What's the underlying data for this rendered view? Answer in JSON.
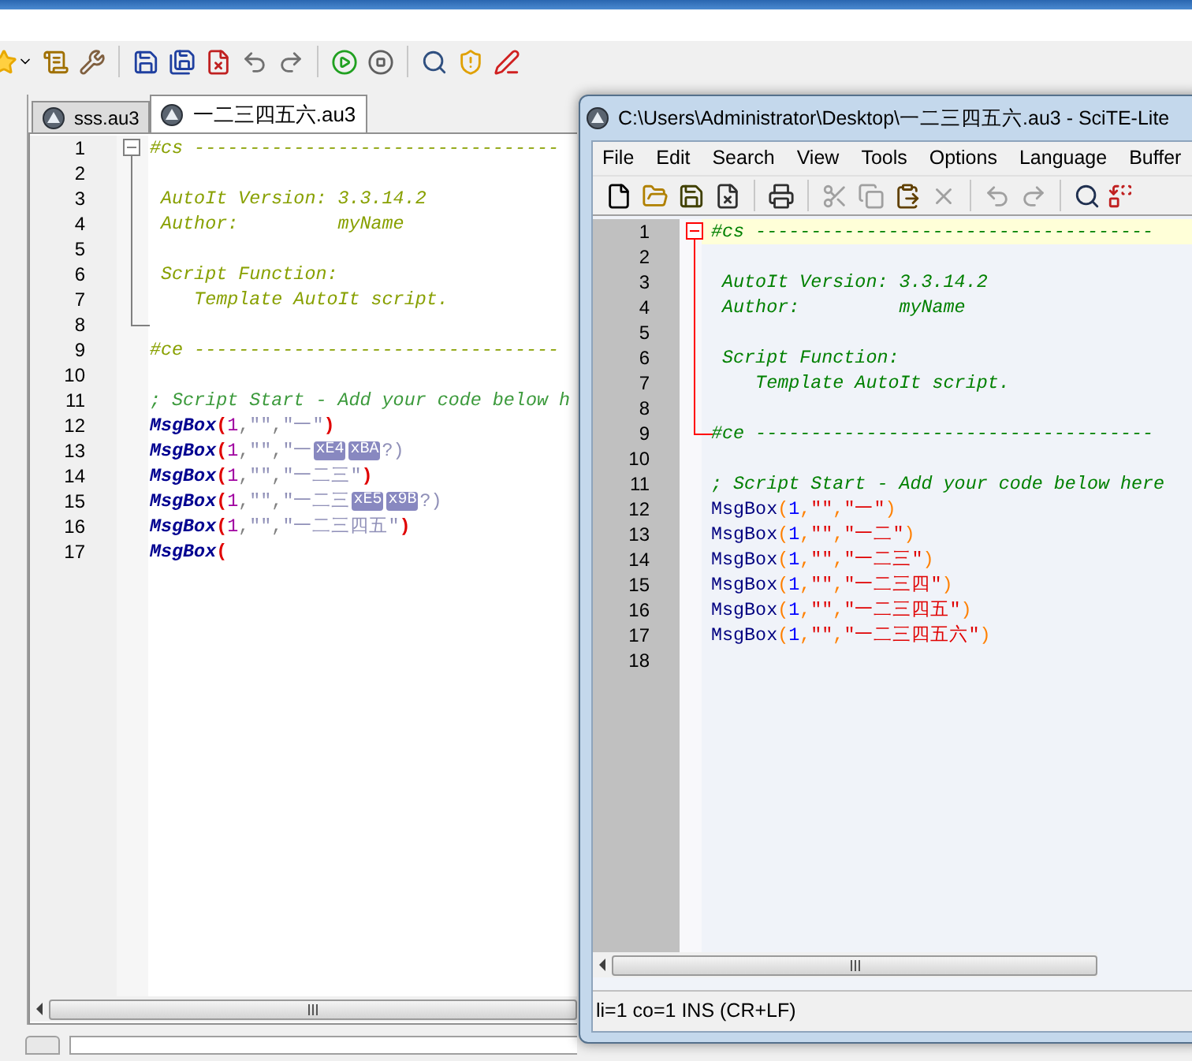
{
  "main_window": {
    "tabs": [
      {
        "label": "sss.au3",
        "selected": false
      },
      {
        "label": "一二三四五六.au3",
        "selected": true
      }
    ],
    "editor": {
      "lines": [
        {
          "number": "1",
          "expanded": true,
          "tokens": [
            {
              "kind": "block_comment",
              "text": "#cs ---------------------------------"
            }
          ],
          "children": [
            {
              "number": "2"
            },
            {
              "number": "3",
              "tokens": [
                {
                  "kind": "block_comment",
                  "text": " AutoIt Version: 3.3.14.2"
                }
              ]
            },
            {
              "number": "4",
              "tokens": [
                {
                  "kind": "block_comment",
                  "text": " Author:         myName"
                }
              ]
            },
            {
              "number": "5"
            },
            {
              "number": "6",
              "tokens": [
                {
                  "kind": "block_comment",
                  "text": " Script Function:"
                }
              ]
            },
            {
              "number": "7",
              "tokens": [
                {
                  "kind": "block_comment",
                  "text": "    Template AutoIt script."
                }
              ]
            },
            {
              "number": "8"
            }
          ]
        },
        {
          "number": "9",
          "tokens": [
            {
              "kind": "block_comment",
              "text": "#ce ---------------------------------"
            }
          ]
        },
        {
          "number": "10"
        },
        {
          "number": "11",
          "tokens": [
            {
              "kind": "line_comment",
              "text": "; Script Start - Add your code below h"
            }
          ]
        },
        {
          "number": "12",
          "tokens": [
            {
              "kind": "func",
              "text": "MsgBox"
            },
            {
              "kind": "paren",
              "text": "("
            },
            {
              "kind": "num",
              "text": "1"
            },
            {
              "kind": "op",
              "text": ","
            },
            {
              "kind": "str",
              "text": "\"\""
            },
            {
              "kind": "op",
              "text": ","
            },
            {
              "kind": "str",
              "text": "\"一\""
            },
            {
              "kind": "paren",
              "text": ")"
            }
          ]
        },
        {
          "number": "13",
          "tokens": [
            {
              "kind": "func",
              "text": "MsgBox"
            },
            {
              "kind": "paren",
              "text": "("
            },
            {
              "kind": "num",
              "text": "1"
            },
            {
              "kind": "op",
              "text": ","
            },
            {
              "kind": "str",
              "text": "\"\""
            },
            {
              "kind": "op",
              "text": ","
            },
            {
              "kind": "str",
              "text": "\"一"
            },
            {
              "kind": "byte",
              "text": "xE4"
            },
            {
              "kind": "byte",
              "text": "xBA"
            },
            {
              "kind": "str",
              "text": "?)"
            }
          ]
        },
        {
          "number": "14",
          "tokens": [
            {
              "kind": "func",
              "text": "MsgBox"
            },
            {
              "kind": "paren",
              "text": "("
            },
            {
              "kind": "num",
              "text": "1"
            },
            {
              "kind": "op",
              "text": ","
            },
            {
              "kind": "str",
              "text": "\"\""
            },
            {
              "kind": "op",
              "text": ","
            },
            {
              "kind": "str",
              "text": "\"一二三\""
            },
            {
              "kind": "paren",
              "text": ")"
            }
          ]
        },
        {
          "number": "15",
          "tokens": [
            {
              "kind": "func",
              "text": "MsgBox"
            },
            {
              "kind": "paren",
              "text": "("
            },
            {
              "kind": "num",
              "text": "1"
            },
            {
              "kind": "op",
              "text": ","
            },
            {
              "kind": "str",
              "text": "\"\""
            },
            {
              "kind": "op",
              "text": ","
            },
            {
              "kind": "str",
              "text": "\"一二三"
            },
            {
              "kind": "byte",
              "text": "xE5"
            },
            {
              "kind": "byte",
              "text": "x9B"
            },
            {
              "kind": "str",
              "text": "?)"
            }
          ]
        },
        {
          "number": "16",
          "tokens": [
            {
              "kind": "func",
              "text": "MsgBox"
            },
            {
              "kind": "paren",
              "text": "("
            },
            {
              "kind": "num",
              "text": "1"
            },
            {
              "kind": "op",
              "text": ","
            },
            {
              "kind": "str",
              "text": "\"\""
            },
            {
              "kind": "op",
              "text": ","
            },
            {
              "kind": "str",
              "text": "\"一二三四五\""
            },
            {
              "kind": "paren",
              "text": ")"
            }
          ]
        },
        {
          "number": "17",
          "tokens": [
            {
              "kind": "func",
              "text": "MsgBox"
            },
            {
              "kind": "paren",
              "text": "("
            }
          ]
        }
      ]
    }
  },
  "scite_window": {
    "title": "C:\\Users\\Administrator\\Desktop\\一二三四五六.au3 - SciTE-Lite",
    "menu": [
      "File",
      "Edit",
      "Search",
      "View",
      "Tools",
      "Options",
      "Language",
      "Buffer"
    ],
    "editor": {
      "lines": [
        {
          "number": "1",
          "expanded": true,
          "current": true,
          "tokens": [
            {
              "kind": "block_comment",
              "text": "#cs ------------------------------------"
            }
          ],
          "children": [
            {
              "number": "2",
              "current": false
            },
            {
              "number": "3",
              "current": false,
              "tokens": [
                {
                  "kind": "block_comment",
                  "text": " AutoIt Version: 3.3.14.2"
                }
              ]
            },
            {
              "number": "4",
              "current": false,
              "tokens": [
                {
                  "kind": "block_comment",
                  "text": " Author:         myName"
                }
              ]
            },
            {
              "number": "5",
              "current": false
            },
            {
              "number": "6",
              "current": false,
              "tokens": [
                {
                  "kind": "block_comment",
                  "text": " Script Function:"
                }
              ]
            },
            {
              "number": "7",
              "current": false,
              "tokens": [
                {
                  "kind": "block_comment",
                  "text": "    Template AutoIt script."
                }
              ]
            },
            {
              "number": "8",
              "current": false
            },
            {
              "number": "9",
              "current": false,
              "tokens": [
                {
                  "kind": "block_comment",
                  "text": "#ce ------------------------------------"
                }
              ]
            }
          ]
        },
        {
          "number": "10",
          "current": false
        },
        {
          "number": "11",
          "current": false,
          "tokens": [
            {
              "kind": "line_comment",
              "text": "; Script Start - Add your code below here"
            }
          ]
        },
        {
          "number": "12",
          "current": false,
          "tokens": [
            {
              "kind": "func",
              "text": "MsgBox"
            },
            {
              "kind": "paren",
              "text": "("
            },
            {
              "kind": "num",
              "text": "1"
            },
            {
              "kind": "op",
              "text": ","
            },
            {
              "kind": "str",
              "text": "\"\""
            },
            {
              "kind": "op",
              "text": ","
            },
            {
              "kind": "str",
              "text": "\"一\""
            },
            {
              "kind": "paren",
              "text": ")"
            }
          ]
        },
        {
          "number": "13",
          "current": false,
          "tokens": [
            {
              "kind": "func",
              "text": "MsgBox"
            },
            {
              "kind": "paren",
              "text": "("
            },
            {
              "kind": "num",
              "text": "1"
            },
            {
              "kind": "op",
              "text": ","
            },
            {
              "kind": "str",
              "text": "\"\""
            },
            {
              "kind": "op",
              "text": ","
            },
            {
              "kind": "str",
              "text": "\"一二\""
            },
            {
              "kind": "paren",
              "text": ")"
            }
          ]
        },
        {
          "number": "14",
          "current": false,
          "tokens": [
            {
              "kind": "func",
              "text": "MsgBox"
            },
            {
              "kind": "paren",
              "text": "("
            },
            {
              "kind": "num",
              "text": "1"
            },
            {
              "kind": "op",
              "text": ","
            },
            {
              "kind": "str",
              "text": "\"\""
            },
            {
              "kind": "op",
              "text": ","
            },
            {
              "kind": "str",
              "text": "\"一二三\""
            },
            {
              "kind": "paren",
              "text": ")"
            }
          ]
        },
        {
          "number": "15",
          "current": false,
          "tokens": [
            {
              "kind": "func",
              "text": "MsgBox"
            },
            {
              "kind": "paren",
              "text": "("
            },
            {
              "kind": "num",
              "text": "1"
            },
            {
              "kind": "op",
              "text": ","
            },
            {
              "kind": "str",
              "text": "\"\""
            },
            {
              "kind": "op",
              "text": ","
            },
            {
              "kind": "str",
              "text": "\"一二三四\""
            },
            {
              "kind": "paren",
              "text": ")"
            }
          ]
        },
        {
          "number": "16",
          "current": false,
          "tokens": [
            {
              "kind": "func",
              "text": "MsgBox"
            },
            {
              "kind": "paren",
              "text": "("
            },
            {
              "kind": "num",
              "text": "1"
            },
            {
              "kind": "op",
              "text": ","
            },
            {
              "kind": "str",
              "text": "\"\""
            },
            {
              "kind": "op",
              "text": ","
            },
            {
              "kind": "str",
              "text": "\"一二三四五\""
            },
            {
              "kind": "paren",
              "text": ")"
            }
          ]
        },
        {
          "number": "17",
          "current": false,
          "tokens": [
            {
              "kind": "func",
              "text": "MsgBox"
            },
            {
              "kind": "paren",
              "text": "("
            },
            {
              "kind": "num",
              "text": "1"
            },
            {
              "kind": "op",
              "text": ","
            },
            {
              "kind": "str",
              "text": "\"\""
            },
            {
              "kind": "op",
              "text": ","
            },
            {
              "kind": "str",
              "text": "\"一二三四五六\""
            },
            {
              "kind": "paren",
              "text": ")"
            }
          ]
        },
        {
          "number": "18",
          "current": false
        }
      ]
    },
    "status_bar": "li=1 co=1 INS (CR+LF)"
  }
}
